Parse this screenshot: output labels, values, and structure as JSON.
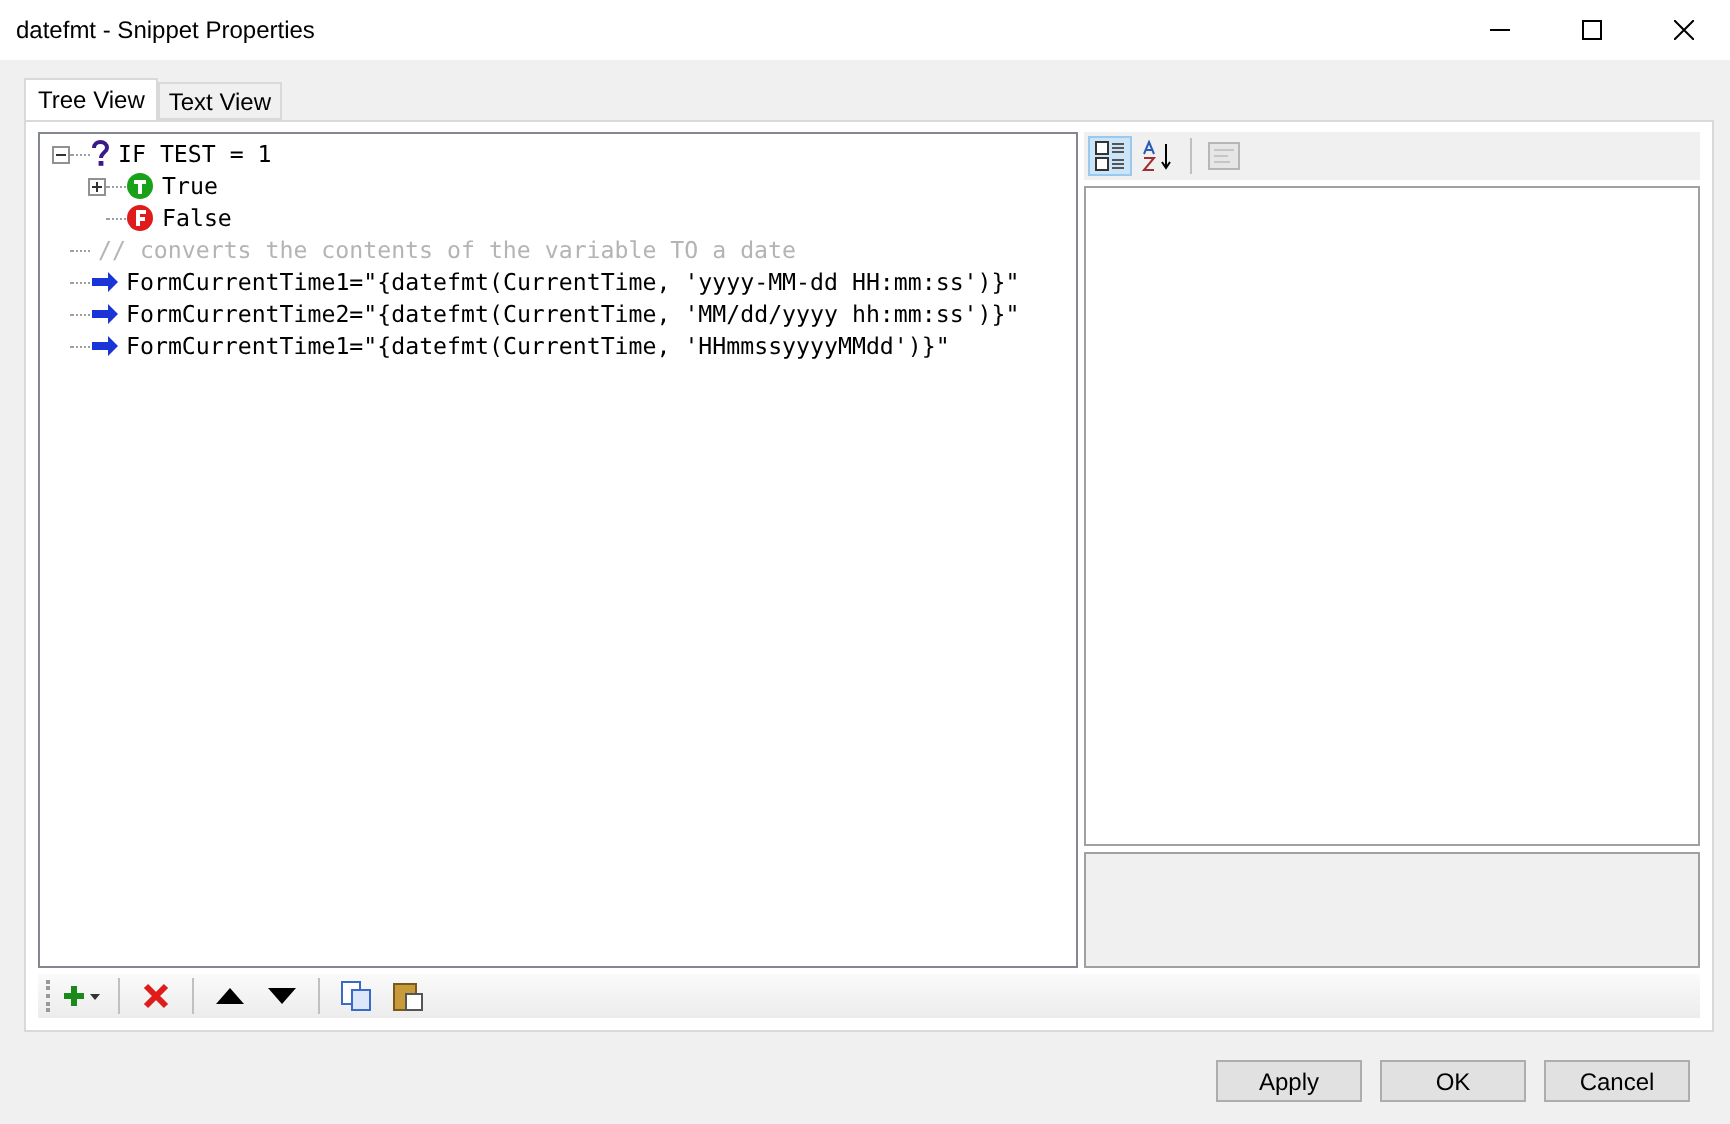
{
  "window": {
    "title": "datefmt - Snippet Properties"
  },
  "tabs": [
    {
      "label": "Tree View",
      "selected": true
    },
    {
      "label": "Text View",
      "selected": false
    }
  ],
  "tree": [
    {
      "kind": "condition",
      "text": "IF TEST = 1",
      "expanded": true,
      "children": [
        {
          "kind": "true",
          "text": "True",
          "expanded": false
        },
        {
          "kind": "false",
          "text": "False"
        }
      ]
    },
    {
      "kind": "comment",
      "text": "// converts the contents of the variable TO a date"
    },
    {
      "kind": "assign",
      "text": "FormCurrentTime1=\"{datefmt(CurrentTime, 'yyyy-MM-dd HH:mm:ss')}\""
    },
    {
      "kind": "assign",
      "text": "FormCurrentTime2=\"{datefmt(CurrentTime, 'MM/dd/yyyy hh:mm:ss')}\""
    },
    {
      "kind": "assign",
      "text": "FormCurrentTime1=\"{datefmt(CurrentTime, 'HHmmssyyyyMMdd')}\""
    }
  ],
  "property_toolbar": [
    {
      "kind": "categorized",
      "selected": true
    },
    {
      "kind": "alphabetical",
      "selected": false
    },
    {
      "kind": "pages",
      "disabled": true
    }
  ],
  "buttons": [
    "Apply",
    "OK",
    "Cancel"
  ]
}
